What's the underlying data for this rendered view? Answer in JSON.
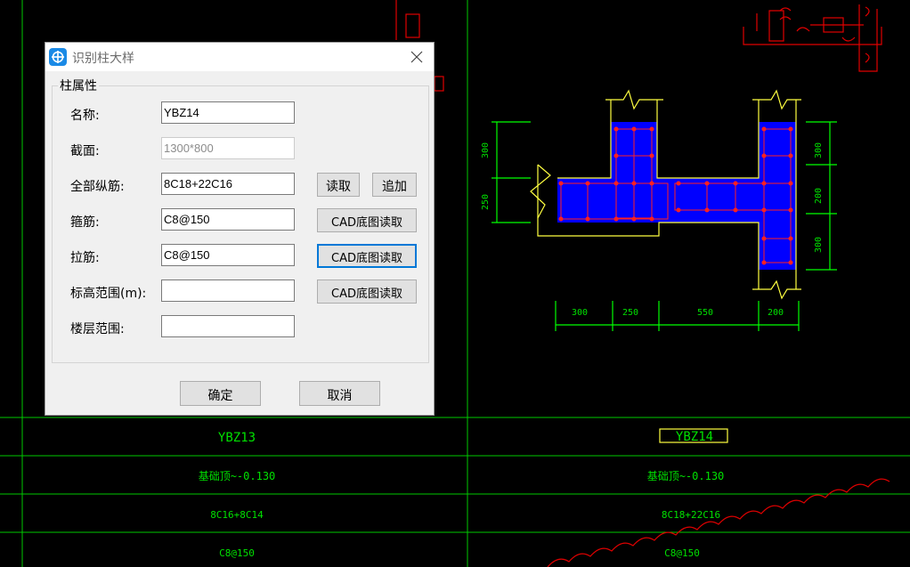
{
  "dialog": {
    "title": "识别柱大样",
    "group_label": "柱属性",
    "fields": [
      {
        "label": "名称:",
        "value": "YBZ14",
        "disabled": false
      },
      {
        "label": "截面:",
        "value": "1300*800",
        "disabled": true
      },
      {
        "label": "全部纵筋:",
        "value": "8C18+22C16",
        "disabled": false
      },
      {
        "label": "箍筋:",
        "value": "C8@150",
        "disabled": false
      },
      {
        "label": "拉筋:",
        "value": "C8@150",
        "disabled": false
      },
      {
        "label": "标高范围(m):",
        "value": "",
        "disabled": false
      },
      {
        "label": "楼层范围:",
        "value": "",
        "disabled": false
      }
    ],
    "read_button": "读取",
    "append_button": "追加",
    "cad_read_button": "CAD底图读取",
    "ok_button": "确定",
    "cancel_button": "取消"
  },
  "cad": {
    "dims_bottom": [
      "300",
      "250",
      "550",
      "200"
    ],
    "dims_left": [
      "300",
      "250"
    ],
    "dims_right": [
      "300",
      "200",
      "300"
    ],
    "table_cells": [
      [
        "YBZ13",
        "YBZ14"
      ],
      [
        "基础顶~-0.130",
        "基础顶~-0.130"
      ],
      [
        "8C16+8C14",
        "8C18+22C16"
      ],
      [
        "C8@150",
        "C8@150"
      ]
    ],
    "colors": {
      "background": "#000000",
      "grid": "#00c800",
      "text": "#00e000",
      "annotation_red": "#e00000",
      "fill_blue": "#0000ff",
      "outline_yellow": "#ffff40",
      "dim_green": "#00ff00"
    }
  }
}
